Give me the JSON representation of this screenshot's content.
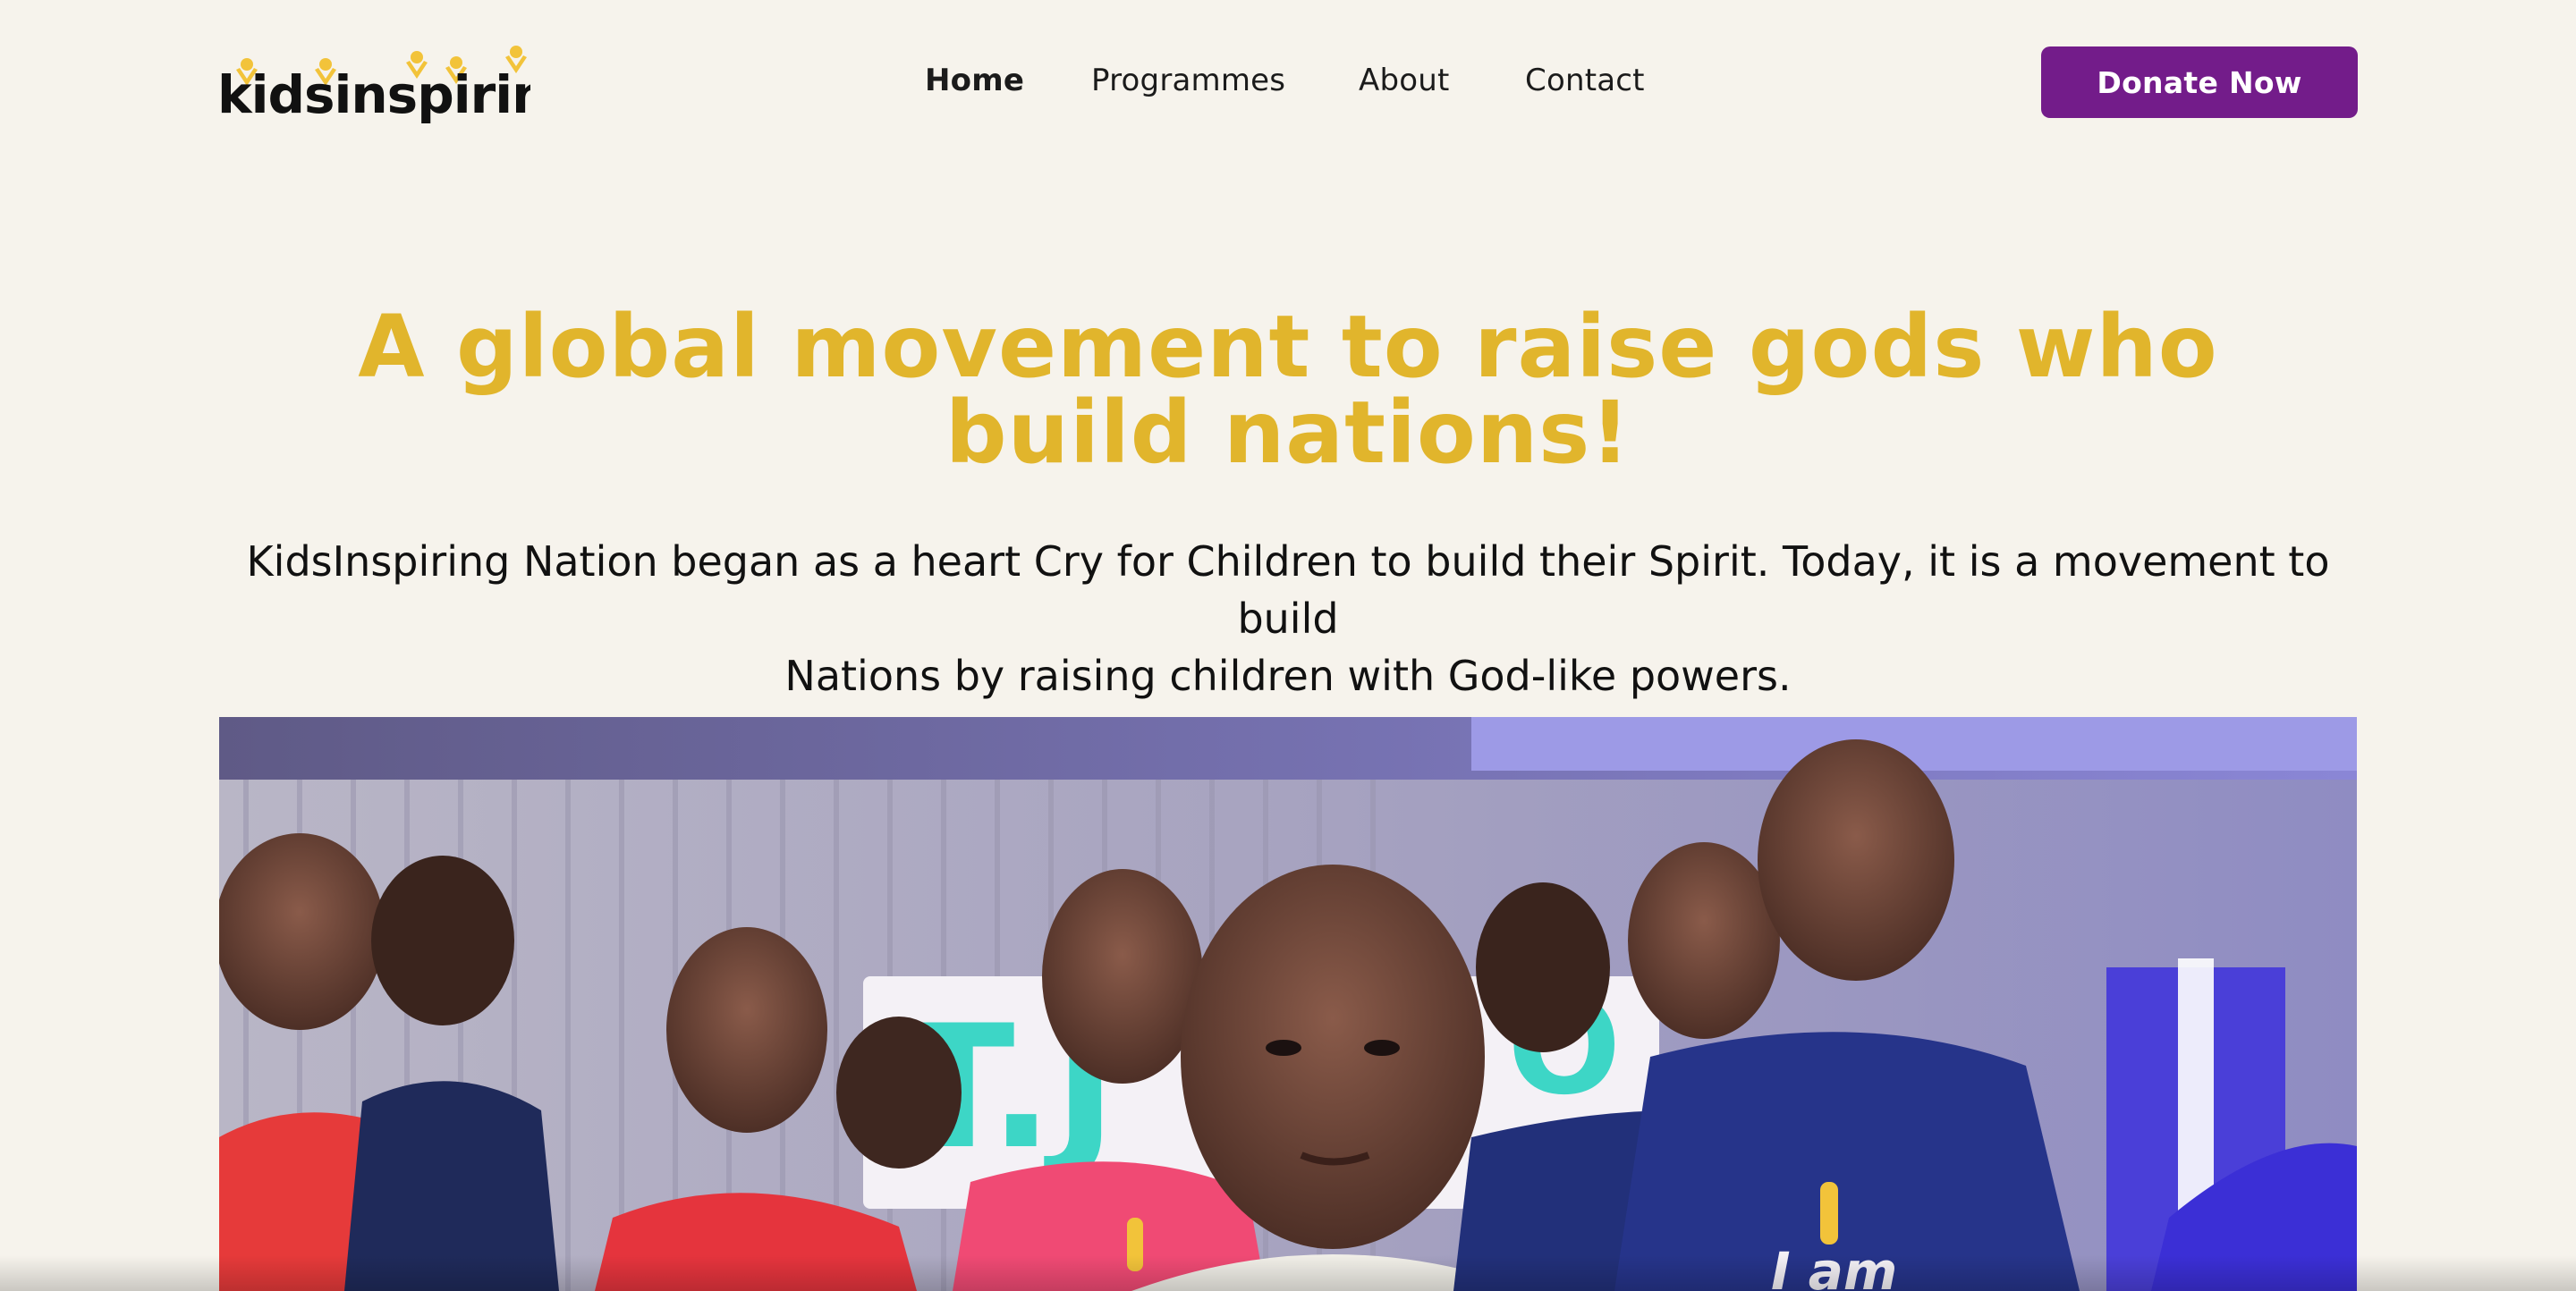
{
  "header": {
    "logo": {
      "text": "kidsinspiring",
      "colors": {
        "text": "#111111",
        "figures": "#f2c33a"
      }
    },
    "nav": [
      {
        "label": "Home",
        "active": true
      },
      {
        "label": "Programmes",
        "active": false
      },
      {
        "label": "About",
        "active": false
      },
      {
        "label": "Contact",
        "active": false
      }
    ],
    "donate_label": "Donate Now"
  },
  "hero": {
    "title_line1": "A global movement to raise gods who",
    "title_line2": "build nations!",
    "subtitle_line1": "KidsInspiring Nation began as a heart Cry for Children to build their Spirit. Today, it is a movement to build",
    "subtitle_line2": "Nations by raising children with God-like powers."
  },
  "hero_image": {
    "description_icon": "group-of-children-photo",
    "shirt_text": "I am"
  },
  "colors": {
    "background": "#f6f3ec",
    "accent_yellow": "#e1b52c",
    "brand_purple": "#731c8a",
    "text": "#111111"
  }
}
